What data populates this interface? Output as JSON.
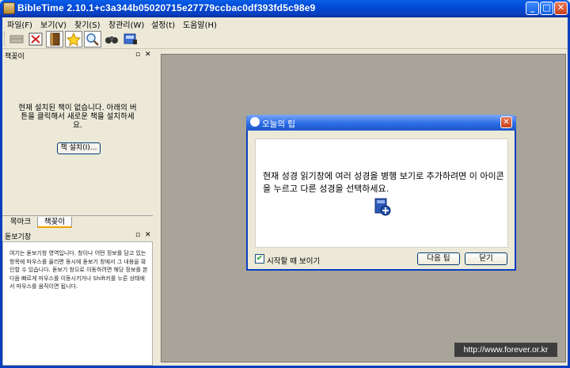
{
  "window": {
    "title": "BibleTime 2.10.1+c3a344b05020715e27779ccbac0df393fd5c98e9",
    "minimize": "_",
    "maximize": "□",
    "close": "✕"
  },
  "menu": [
    {
      "label": "파일(F)"
    },
    {
      "label": "보기(V)"
    },
    {
      "label": "찾기(S)"
    },
    {
      "label": "창관리(W)"
    },
    {
      "label": "설정(t)"
    },
    {
      "label": "도움말(H)"
    }
  ],
  "toolbar": {
    "icons": [
      "bookshelf-icon",
      "fullscreen-icon",
      "book-icon",
      "star-icon",
      "magnifier-icon",
      "binoculars-icon",
      "info-display-icon"
    ]
  },
  "bookshelf_panel": {
    "title": "책꽂이",
    "float": "▫",
    "close": "✕",
    "empty_message": "현재 설치된 책이 없습니다. 아래의 버튼을 클릭해서 새로운 책을 설치하세요.",
    "install_button": "책 설치(I)..."
  },
  "tabs": [
    {
      "label": "목마크",
      "active": false
    },
    {
      "label": "책꽂이",
      "active": true
    }
  ],
  "info_panel": {
    "title": "돋보기창",
    "float": "▫",
    "close": "✕",
    "text": "여기는 돋보기창 영역입니다. 창이나 어떤 정보를 담고 있는 항목에 마우스를 올리면 동시에 돋보기 창에서 그 내용을 확인할 수 있습니다. 돋보기 창으로 이동하려면 해당 정보를 본 다음 빠르게 마우스를 이동시키거나 Shift키를 누른 상태에서 마우스를 움직이면 됩니다."
  },
  "tip_dialog": {
    "title": "오늘의 팁",
    "close": "✕",
    "tip": "현재 성경 읽기창에 여러 성경을 병행 보기로 추가하려면 이 아이콘을 누르고 다른 성경을 선택하세요.",
    "checkbox_label": "시작할 때 보이기",
    "checkbox_mark": "✔",
    "checked": true,
    "next_button": "다음 팁",
    "close_button": "닫기"
  },
  "watermark": "http://www.forever.or.kr",
  "colors": {
    "title_bar": "#0a47d4",
    "mdi_background": "#a8a49a",
    "tab_accent": "#f0a000"
  }
}
